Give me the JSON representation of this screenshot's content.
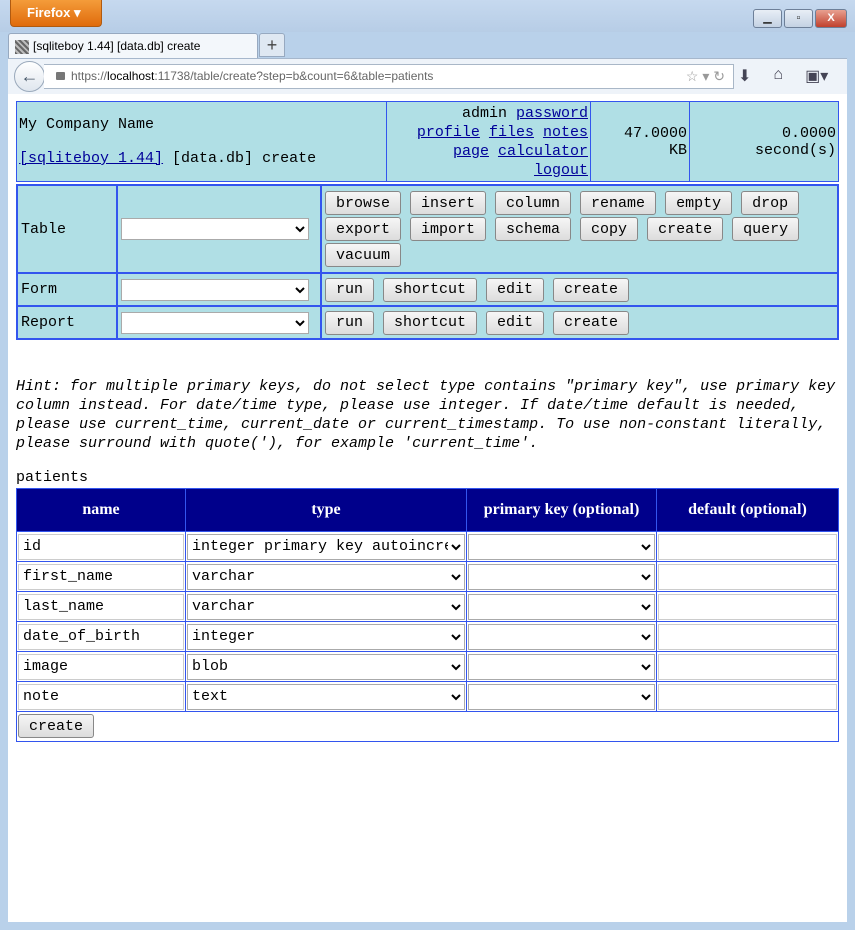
{
  "browser": {
    "menu_label": "Firefox",
    "tab_title": "[sqliteboy 1.44] [data.db] create",
    "url_prefix": "https://",
    "url_host": "localhost",
    "url_rest": ":11738/table/create?step=b&count=6&table=patients"
  },
  "header": {
    "company": "My Company Name",
    "app_link": "[sqliteboy 1.44]",
    "db": "[data.db]",
    "action": "create",
    "user": "admin",
    "links": [
      "password",
      "profile",
      "files",
      "notes",
      "page",
      "calculator",
      "logout"
    ],
    "size_value": "47.0000",
    "size_unit": "KB",
    "time_value": "0.0000",
    "time_unit": "second(s)"
  },
  "nav": {
    "table_label": "Table",
    "table_buttons": [
      "browse",
      "insert",
      "column",
      "rename",
      "empty",
      "drop",
      "export",
      "import",
      "schema",
      "copy",
      "create",
      "query",
      "vacuum"
    ],
    "form_label": "Form",
    "form_buttons": [
      "run",
      "shortcut",
      "edit",
      "create"
    ],
    "report_label": "Report",
    "report_buttons": [
      "run",
      "shortcut",
      "edit",
      "create"
    ]
  },
  "hint": "Hint: for multiple primary keys, do not select type contains \"primary key\", use primary key column instead. For date/time type, please use integer. If date/time default is needed, please use current_time, current_date or current_timestamp. To use non-constant literally, please surround with quote('), for example 'current_time'.",
  "table_name": "patients",
  "columns_header": [
    "name",
    "type",
    "primary key (optional)",
    "default (optional)"
  ],
  "columns": [
    {
      "name": "id",
      "type": "integer primary key autoincrement",
      "pk": "",
      "default": ""
    },
    {
      "name": "first_name",
      "type": "varchar",
      "pk": "",
      "default": ""
    },
    {
      "name": "last_name",
      "type": "varchar",
      "pk": "",
      "default": ""
    },
    {
      "name": "date_of_birth",
      "type": "integer",
      "pk": "",
      "default": ""
    },
    {
      "name": "image",
      "type": "blob",
      "pk": "",
      "default": ""
    },
    {
      "name": "note",
      "type": "text",
      "pk": "",
      "default": ""
    }
  ],
  "create_label": "create"
}
